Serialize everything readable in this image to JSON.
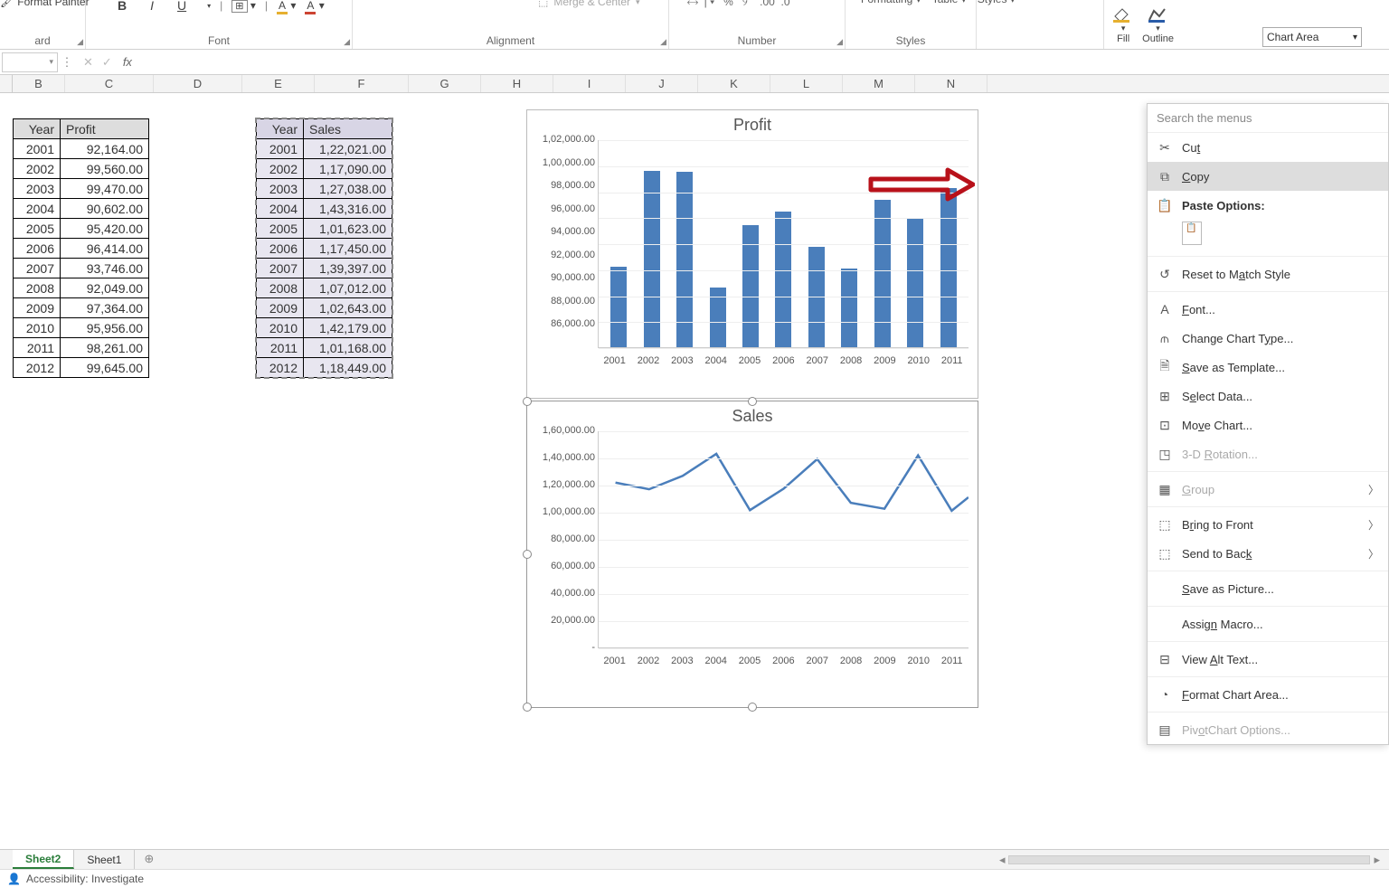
{
  "ribbon": {
    "format_painter": "Format Painter",
    "groups": {
      "clipboard": "Clipboard",
      "clipboard_short": "ard",
      "font": "Font",
      "alignment": "Alignment",
      "number": "Number",
      "styles": "Styles"
    },
    "merge_center": "Merge & Center",
    "styles_items": {
      "formatting": "Formatting",
      "table": "Table",
      "styles_dd": "Styles"
    },
    "shape_fill": "Fill",
    "shape_outline": "Outline",
    "chart_element_selector": "Chart Area"
  },
  "columns": [
    "B",
    "C",
    "D",
    "E",
    "F",
    "G",
    "H",
    "I",
    "J",
    "K",
    "L",
    "M",
    "N"
  ],
  "table1": {
    "headers": [
      "Year",
      "Profit"
    ],
    "rows": [
      [
        "2001",
        "92,164.00"
      ],
      [
        "2002",
        "99,560.00"
      ],
      [
        "2003",
        "99,470.00"
      ],
      [
        "2004",
        "90,602.00"
      ],
      [
        "2005",
        "95,420.00"
      ],
      [
        "2006",
        "96,414.00"
      ],
      [
        "2007",
        "93,746.00"
      ],
      [
        "2008",
        "92,049.00"
      ],
      [
        "2009",
        "97,364.00"
      ],
      [
        "2010",
        "95,956.00"
      ],
      [
        "2011",
        "98,261.00"
      ],
      [
        "2012",
        "99,645.00"
      ]
    ]
  },
  "table2": {
    "headers": [
      "Year",
      "Sales"
    ],
    "rows": [
      [
        "2001",
        "1,22,021.00"
      ],
      [
        "2002",
        "1,17,090.00"
      ],
      [
        "2003",
        "1,27,038.00"
      ],
      [
        "2004",
        "1,43,316.00"
      ],
      [
        "2005",
        "1,01,623.00"
      ],
      [
        "2006",
        "1,17,450.00"
      ],
      [
        "2007",
        "1,39,397.00"
      ],
      [
        "2008",
        "1,07,012.00"
      ],
      [
        "2009",
        "1,02,643.00"
      ],
      [
        "2010",
        "1,42,179.00"
      ],
      [
        "2011",
        "1,01,168.00"
      ],
      [
        "2012",
        "1,18,449.00"
      ]
    ]
  },
  "chart_data": [
    {
      "type": "bar",
      "title": "Profit",
      "categories": [
        "2001",
        "2002",
        "2003",
        "2004",
        "2005",
        "2006",
        "2007",
        "2008",
        "2009",
        "2010",
        "2011"
      ],
      "values": [
        92164,
        99560,
        99470,
        90602,
        95420,
        96414,
        93746,
        92049,
        97364,
        95956,
        98261
      ],
      "ylim": [
        86000,
        102000
      ],
      "yticks": [
        "1,02,000.00",
        "1,00,000.00",
        "98,000.00",
        "96,000.00",
        "94,000.00",
        "92,000.00",
        "90,000.00",
        "88,000.00",
        "86,000.00"
      ]
    },
    {
      "type": "line",
      "title": "Sales",
      "categories": [
        "2001",
        "2002",
        "2003",
        "2004",
        "2005",
        "2006",
        "2007",
        "2008",
        "2009",
        "2010",
        "2011"
      ],
      "values": [
        122021,
        117090,
        127038,
        143316,
        101623,
        117450,
        139397,
        107012,
        102643,
        142179,
        101168
      ],
      "ylim": [
        0,
        160000
      ],
      "yticks": [
        "1,60,000.00",
        "1,40,000.00",
        "1,20,000.00",
        "1,00,000.00",
        "80,000.00",
        "60,000.00",
        "40,000.00",
        "20,000.00",
        "-"
      ]
    }
  ],
  "context_menu": {
    "search_placeholder": "Search the menus",
    "items": [
      {
        "icon": "cut",
        "label": "Cut",
        "accel": "t"
      },
      {
        "icon": "copy",
        "label": "Copy",
        "accel": "C",
        "highlight": true
      },
      {
        "icon": "paste",
        "label": "Paste Options:",
        "bold": true
      },
      {
        "paste_options": true
      },
      {
        "sep": true
      },
      {
        "icon": "reset",
        "label": "Reset to Match Style",
        "accel": "A"
      },
      {
        "sep": true
      },
      {
        "icon": "font",
        "label": "Font...",
        "accel": "F"
      },
      {
        "icon": "chart",
        "label": "Change Chart Type...",
        "accel": "y"
      },
      {
        "icon": "savetpl",
        "label": "Save as Template...",
        "accel": "S"
      },
      {
        "icon": "seldata",
        "label": "Select Data...",
        "accel": "e"
      },
      {
        "icon": "movechart",
        "label": "Move Chart...",
        "accel": "v"
      },
      {
        "icon": "cube",
        "label": "3-D Rotation...",
        "accel": "R",
        "disabled": true
      },
      {
        "sep": true
      },
      {
        "icon": "group",
        "label": "Group",
        "accel": "G",
        "disabled": true,
        "submenu": true
      },
      {
        "sep": true
      },
      {
        "icon": "front",
        "label": "Bring to Front",
        "accel": "r",
        "submenu": true
      },
      {
        "icon": "back",
        "label": "Send to Back",
        "accel": "k",
        "submenu": true
      },
      {
        "sep": true
      },
      {
        "icon": "",
        "label": "Save as Picture...",
        "accel": "S"
      },
      {
        "sep": true
      },
      {
        "icon": "",
        "label": "Assign Macro...",
        "accel": "n"
      },
      {
        "sep": true
      },
      {
        "icon": "alttext",
        "label": "View Alt Text...",
        "accel": "A"
      },
      {
        "sep": true
      },
      {
        "icon": "fmt",
        "label": "Format Chart Area...",
        "accel": "F"
      },
      {
        "sep": true
      },
      {
        "icon": "pivot",
        "label": "PivotChart Options...",
        "accel": "O",
        "disabled": true
      }
    ]
  },
  "tabs": {
    "active": "Sheet2",
    "other": "Sheet1"
  },
  "status": {
    "accessibility": "Accessibility: Investigate"
  }
}
